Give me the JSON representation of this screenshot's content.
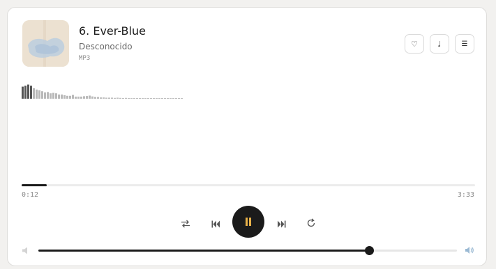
{
  "track": {
    "title": "6. Ever-Blue",
    "artist": "Desconocido",
    "format": "MP3"
  },
  "actions": [
    {
      "name": "like-button",
      "icon": "heart-icon",
      "glyph": "♡"
    },
    {
      "name": "lyrics-button",
      "icon": "music-note-icon",
      "glyph": "♩"
    },
    {
      "name": "playlist-button",
      "icon": "list-icon",
      "glyph": "☰"
    }
  ],
  "waveform": {
    "levels": [
      0.58,
      0.62,
      0.68,
      0.62,
      0.5,
      0.44,
      0.4,
      0.36,
      0.3,
      0.32,
      0.26,
      0.28,
      0.26,
      0.2,
      0.2,
      0.17,
      0.14,
      0.14,
      0.18,
      0.1,
      0.1,
      0.1,
      0.12,
      0.13,
      0.15,
      0.11,
      0.08,
      0.08,
      0.06,
      0.06,
      0.05,
      0.05,
      0.05,
      0.04,
      0.05,
      0.04,
      0.03,
      0.04,
      0.03,
      0.03,
      0.03,
      0.03,
      0.03,
      0.02,
      0.02,
      0.02,
      0.02,
      0.02,
      0.02,
      0.02,
      0.01,
      0.01,
      0.02,
      0.01,
      0.01,
      0.01,
      0.02,
      0.01
    ],
    "color_played": "#555555",
    "color_unplayed": "#b9b9b9"
  },
  "playback": {
    "current_time": "0:12",
    "total_time": "3:33",
    "progress": 0.056
  },
  "controls": {
    "shuffle_icon": "shuffle-icon",
    "previous_icon": "previous-track-icon",
    "play_pause_icon": "pause-icon",
    "next_icon": "next-track-icon",
    "repeat_icon": "repeat-icon"
  },
  "volume": {
    "level": 0.79,
    "mute_icon": "speaker-low-icon",
    "max_icon": "speaker-high-icon"
  },
  "colors": {
    "accent": "#1b1b1b",
    "pause_icon": "#e8b24a",
    "volume_icon": "#9ab9d3"
  }
}
